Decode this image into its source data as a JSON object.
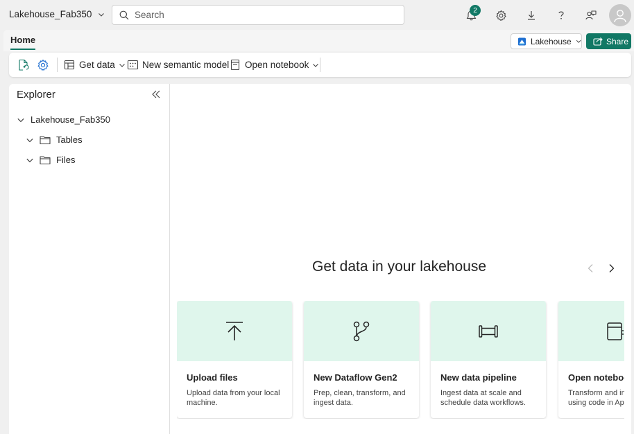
{
  "header": {
    "workspace_title": "Lakehouse_Fab350",
    "search_placeholder": "Search",
    "notification_count": "2"
  },
  "tabbar": {
    "home_tab": "Home",
    "lakehouse_label": "Lakehouse",
    "share_label": "Share"
  },
  "ribbon": {
    "get_data": "Get data",
    "new_semantic_model": "New semantic model",
    "open_notebook": "Open notebook"
  },
  "explorer": {
    "title": "Explorer",
    "root": "Lakehouse_Fab350",
    "items": [
      "Tables",
      "Files"
    ]
  },
  "main": {
    "heading": "Get data in your lakehouse",
    "cards": [
      {
        "title": "Upload files",
        "desc": "Upload data from your local machine.",
        "icon": "upload-icon"
      },
      {
        "title": "New Dataflow Gen2",
        "desc": "Prep, clean, transform, and ingest data.",
        "icon": "dataflow-icon"
      },
      {
        "title": "New data pipeline",
        "desc": "Ingest data at scale and schedule data workflows.",
        "icon": "pipeline-icon"
      },
      {
        "title": "Open notebook",
        "desc": "Transform and ingest data using code in Apache Spark.",
        "icon": "notebook-icon"
      }
    ]
  },
  "colors": {
    "accent": "#117865",
    "card_header": "#dff6ec"
  }
}
